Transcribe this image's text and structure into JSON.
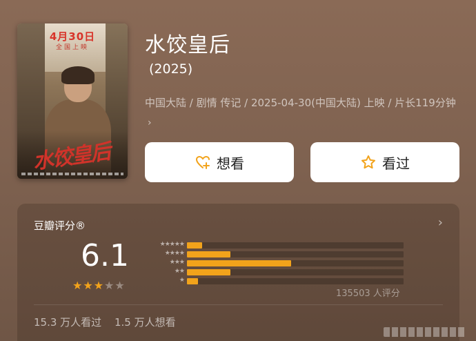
{
  "movie": {
    "title": "水饺皇后",
    "year": "(2025)",
    "meta_line": "中国大陆 / 剧情 传记 / 2025-04-30(中国大陆) 上映 / 片长119分钟",
    "poster": {
      "date_text": "4月30日",
      "release_text": "全国上映",
      "title_art": "水饺皇后"
    }
  },
  "actions": {
    "want_label": "想看",
    "seen_label": "看过"
  },
  "rating": {
    "header": "豆瓣评分®",
    "score": "6.1",
    "stars_filled": 3,
    "stars_total": 5,
    "distribution": [
      {
        "stars": "★★★★★",
        "fraction": 0.07
      },
      {
        "stars": "★★★★",
        "fraction": 0.2
      },
      {
        "stars": "★★★",
        "fraction": 0.48
      },
      {
        "stars": "★★",
        "fraction": 0.2
      },
      {
        "stars": "★",
        "fraction": 0.05
      }
    ],
    "count_text": "135503 人评分",
    "watched_text": "15.3 万人看过",
    "wish_text": "1.5 万人想看"
  },
  "colors": {
    "accent": "#f2a31b",
    "background": "#7f6250"
  }
}
